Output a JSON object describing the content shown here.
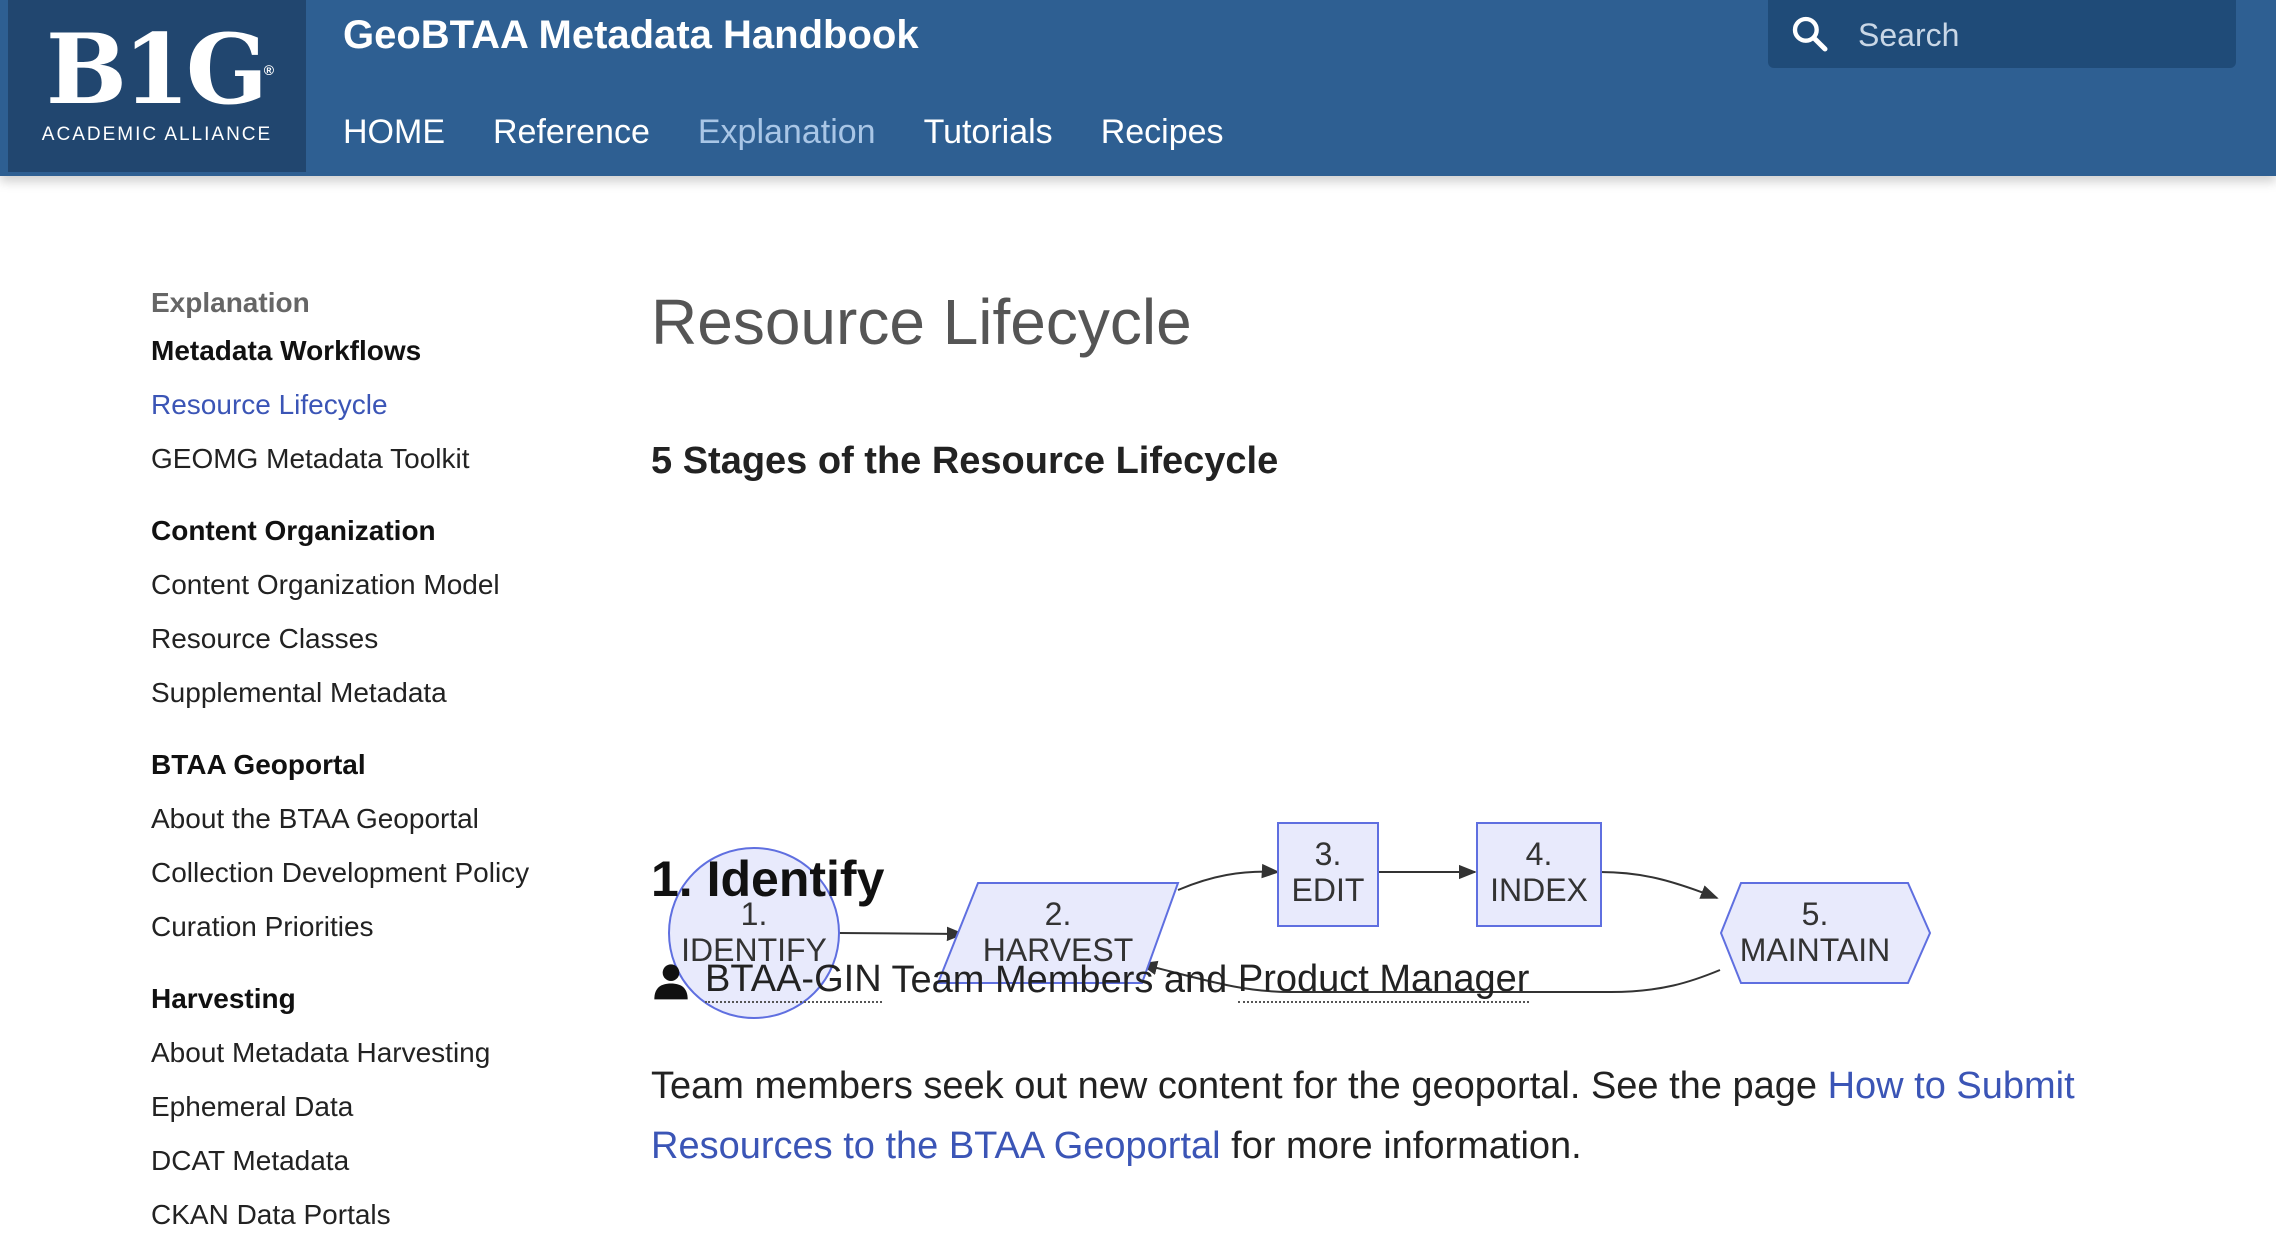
{
  "header": {
    "logo_main": "B1G",
    "logo_sub": "ACADEMIC ALLIANCE",
    "site_title": "GeoBTAA Metadata Handbook",
    "nav": [
      "HOME",
      "Reference",
      "Explanation",
      "Tutorials",
      "Recipes"
    ],
    "nav_active": "Explanation",
    "search_placeholder": "Search"
  },
  "sidebar": {
    "section": "Explanation",
    "groups": [
      {
        "heading": "Metadata Workflows",
        "items": [
          "Resource Lifecycle",
          "GEOMG Metadata Toolkit"
        ]
      },
      {
        "heading": "Content Organization",
        "items": [
          "Content Organization Model",
          "Resource Classes",
          "Supplemental Metadata"
        ]
      },
      {
        "heading": "BTAA Geoportal",
        "items": [
          "About the BTAA Geoportal",
          "Collection Development Policy",
          "Curation Priorities"
        ]
      },
      {
        "heading": "Harvesting",
        "items": [
          "About Metadata Harvesting",
          "Ephemeral Data",
          "DCAT Metadata",
          "CKAN Data Portals"
        ]
      }
    ],
    "current": "Resource Lifecycle"
  },
  "main": {
    "title": "Resource Lifecycle",
    "subheading": "5 Stages of the Resource Lifecycle",
    "diagram": {
      "nodes": [
        {
          "num": "1.",
          "label": "IDENTIFY"
        },
        {
          "num": "2.",
          "label": "HARVEST"
        },
        {
          "num": "3.",
          "label": "EDIT"
        },
        {
          "num": "4.",
          "label": "INDEX"
        },
        {
          "num": "5.",
          "label": "MAINTAIN"
        }
      ],
      "colors": {
        "fill": "#e8eafc",
        "stroke": "#5f6fe0",
        "arrow": "#333333"
      }
    },
    "section_title": "1. Identify",
    "roles": {
      "role1": "BTAA-GIN",
      "middle": " Team Members and ",
      "role2": "Product Manager"
    },
    "paragraph": {
      "text_before": "Team members seek out new content for the geoportal. See the page ",
      "link": "How to Submit Resources to the BTAA Geoportal",
      "text_after": " for more information."
    }
  }
}
